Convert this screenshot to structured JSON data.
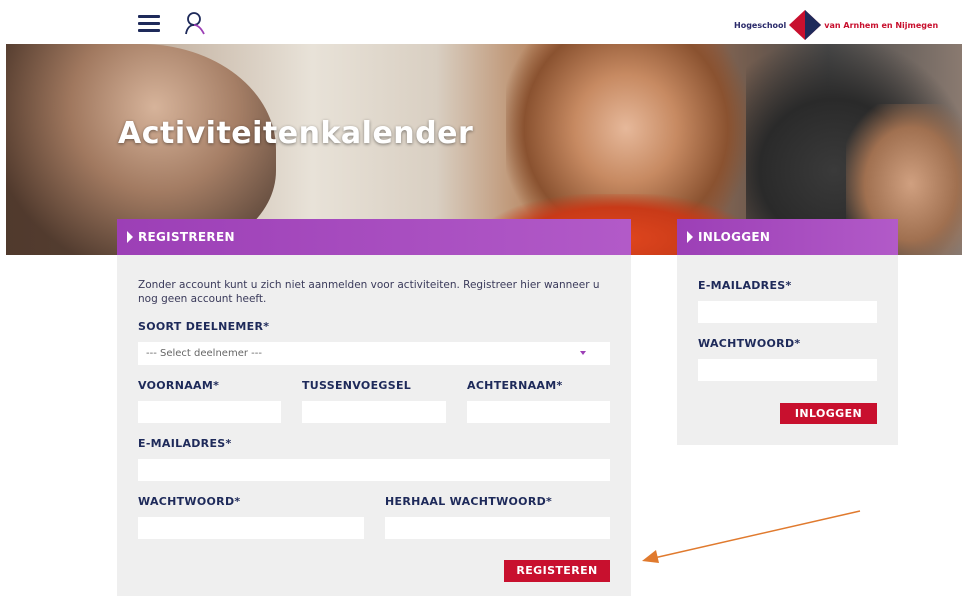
{
  "header": {
    "logo_left": "Hogeschool",
    "logo_right": "van Arnhem en Nijmegen"
  },
  "hero": {
    "title": "Activiteitenkalender"
  },
  "register": {
    "heading": "REGISTREREN",
    "intro": "Zonder account kunt u zich niet aanmelden voor activiteiten. Registreer hier wanneer u nog geen account heeft.",
    "participant_label": "SOORT DEELNEMER*",
    "participant_value": "--- Select deelnemer ---",
    "firstname_label": "VOORNAAM*",
    "infix_label": "TUSSENVOEGSEL",
    "lastname_label": "ACHTERNAAM*",
    "email_label": "E-MAILADRES*",
    "password_label": "WACHTWOORD*",
    "repeat_password_label": "HERHAAL WACHTWOORD*",
    "submit_label": "REGISTEREN"
  },
  "login": {
    "heading": "INLOGGEN",
    "email_label": "E-MAILADRES*",
    "password_label": "WACHTWOORD*",
    "submit_label": "INLOGGEN"
  },
  "colors": {
    "accent_purple": "#9c3fb6",
    "button_red": "#c8102e",
    "navy": "#1e2a5a",
    "annotation_arrow": "#e07a2e"
  }
}
